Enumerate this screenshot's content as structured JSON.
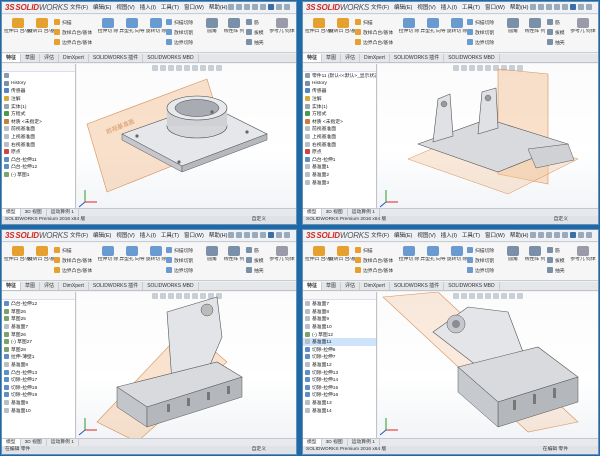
{
  "app": {
    "logo_ds": "3S",
    "logo_solid": "SOLID",
    "logo_works": "WORKS",
    "menu": [
      "文件(F)",
      "编辑(E)",
      "视图(V)",
      "插入(I)",
      "工具(T)",
      "窗口(W)",
      "帮助(H)"
    ],
    "ribbon": {
      "extrude_boss": "拉伸凸\n台/基体",
      "revolve_boss": "旋转凸\n台/基体",
      "sweep": "扫描",
      "loft": "放样凸台/基体",
      "boundary": "边界凸台/基体",
      "extrude_cut": "拉伸切\n除",
      "hole_wizard": "异型孔\n向导",
      "revolve_cut": "旋转切\n除",
      "sweep_cut": "扫描切除",
      "loft_cut": "放样切割",
      "boundary_cut": "边界切除",
      "fillet": "圆角",
      "linear_pattern": "线性阵\n列",
      "rib": "筋",
      "draft": "拔模",
      "shell": "抽壳",
      "wrap": "包覆",
      "intersect": "相交",
      "mirror": "镜向",
      "ref_geometry": "参考几\n何体",
      "curves": "曲线"
    },
    "tabs": [
      "特征",
      "草图",
      "评估",
      "DimXpert",
      "SOLIDWORKS 插件",
      "SOLIDWORKS MBD"
    ],
    "bottom_tabs": [
      "模型",
      "3D 视图",
      "运动算例 1"
    ],
    "colors": {
      "accent": "#d42a20",
      "plane": "#f3c7a0",
      "part": "#d9dadd",
      "selection": "#cde4fb",
      "outer": "#1e6aa8"
    }
  },
  "windows": [
    {
      "id": "q0",
      "status_left": "SOLIDWORKS Premium 2016 x64 版",
      "status_right": "自定义",
      "tree": [
        {
          "label": "",
          "icon": "part-icon"
        },
        {
          "label": "History",
          "icon": "history-icon"
        },
        {
          "label": "传感器",
          "icon": "sensor-icon"
        },
        {
          "label": "注解",
          "icon": "annotation-icon"
        },
        {
          "label": "实体(1)",
          "icon": "solid-body-icon"
        },
        {
          "label": "方程式",
          "icon": "equation-icon"
        },
        {
          "label": "材质 <未指定>",
          "icon": "material-icon"
        },
        {
          "label": "前视基准面",
          "icon": "plane-icon"
        },
        {
          "label": "上视基准面",
          "icon": "plane-icon"
        },
        {
          "label": "右视基准面",
          "icon": "plane-icon"
        },
        {
          "label": "原点",
          "icon": "origin-icon"
        },
        {
          "label": "凸台-拉伸11",
          "icon": "feature-icon"
        },
        {
          "label": "凸台-拉伸12",
          "icon": "feature-icon"
        },
        {
          "label": "(-) 草图1",
          "icon": "sketch-icon"
        }
      ],
      "plane_label": "前视基准面"
    },
    {
      "id": "q1",
      "status_left": "SOLIDWORKS Premium 2016 x64 版",
      "status_right": "自定义",
      "tree": [
        {
          "label": "零件11 (默认<<默认>_显示状态 1>)",
          "icon": "part-icon"
        },
        {
          "label": "History",
          "icon": "history-icon"
        },
        {
          "label": "传感器",
          "icon": "sensor-icon"
        },
        {
          "label": "注解",
          "icon": "annotation-icon"
        },
        {
          "label": "实体(1)",
          "icon": "solid-body-icon"
        },
        {
          "label": "方程式",
          "icon": "equation-icon"
        },
        {
          "label": "材质 <未指定>",
          "icon": "material-icon"
        },
        {
          "label": "前视基准面",
          "icon": "plane-icon"
        },
        {
          "label": "上视基准面",
          "icon": "plane-icon"
        },
        {
          "label": "右视基准面",
          "icon": "plane-icon"
        },
        {
          "label": "原点",
          "icon": "origin-icon"
        },
        {
          "label": "凸台-拉伸1",
          "icon": "feature-icon"
        },
        {
          "label": "基准面1",
          "icon": "plane-icon"
        },
        {
          "label": "基准面2",
          "icon": "plane-icon"
        },
        {
          "label": "基准面3",
          "icon": "plane-icon"
        }
      ]
    },
    {
      "id": "q2",
      "status_left": "在编辑 零件",
      "status_right": "自定义",
      "tree": [
        {
          "label": "凸台-拉伸12",
          "icon": "feature-icon"
        },
        {
          "label": "草图26",
          "icon": "sketch-icon"
        },
        {
          "label": "草图25",
          "icon": "sketch-icon"
        },
        {
          "label": "基准面7",
          "icon": "plane-icon"
        },
        {
          "label": "草图26",
          "icon": "sketch-icon"
        },
        {
          "label": "(-) 草图27",
          "icon": "sketch-icon"
        },
        {
          "label": "草图28",
          "icon": "sketch-icon"
        },
        {
          "label": "拉伸-薄壁1",
          "icon": "feature-icon"
        },
        {
          "label": "基准面8",
          "icon": "plane-icon"
        },
        {
          "label": "凸台-拉伸13",
          "icon": "feature-icon"
        },
        {
          "label": "切除-拉伸17",
          "icon": "feature-icon"
        },
        {
          "label": "切除-拉伸18",
          "icon": "feature-icon"
        },
        {
          "label": "切除-拉伸19",
          "icon": "feature-icon"
        },
        {
          "label": "基准面9",
          "icon": "plane-icon"
        },
        {
          "label": "基准面10",
          "icon": "plane-icon"
        }
      ]
    },
    {
      "id": "q3",
      "status_left": "SOLIDWORKS Premium 2016 x64 版",
      "status_right": "在编辑 零件",
      "tree": [
        {
          "label": "基准面7",
          "icon": "plane-icon"
        },
        {
          "label": "基准面8",
          "icon": "plane-icon"
        },
        {
          "label": "基准面9",
          "icon": "plane-icon"
        },
        {
          "label": "基准面10",
          "icon": "plane-icon"
        },
        {
          "label": "(-) 草图12",
          "icon": "sketch-icon"
        },
        {
          "label": "基准面11",
          "icon": "plane-icon"
        },
        {
          "label": "切除-拉伸6",
          "icon": "feature-icon"
        },
        {
          "label": "切除-拉伸7",
          "icon": "feature-icon"
        },
        {
          "label": "基准面12",
          "icon": "plane-icon"
        },
        {
          "label": "切除-拉伸13",
          "icon": "feature-icon"
        },
        {
          "label": "切除-拉伸14",
          "icon": "feature-icon"
        },
        {
          "label": "切除-拉伸15",
          "icon": "feature-icon"
        },
        {
          "label": "切除-拉伸16",
          "icon": "feature-icon"
        },
        {
          "label": "基准面13",
          "icon": "plane-icon"
        },
        {
          "label": "基准面14",
          "icon": "plane-icon"
        }
      ]
    }
  ]
}
